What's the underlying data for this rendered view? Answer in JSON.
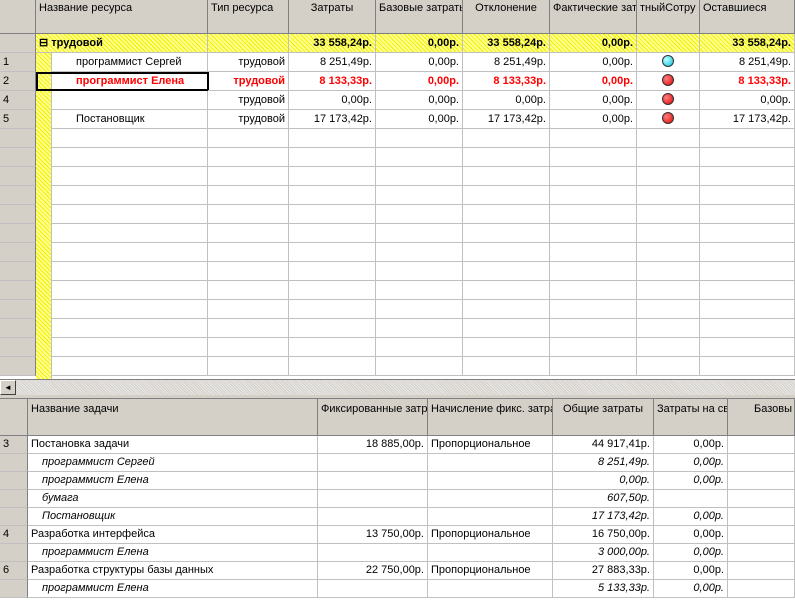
{
  "resource_sheet": {
    "headers": [
      "",
      "Название ресурса",
      "Тип ресурса",
      "Затраты",
      "Базовые затраты",
      "Отклонение",
      "Фактические затраты",
      "тныйСотру",
      "Оставшиеся"
    ],
    "group_row": {
      "name": "трудовой",
      "expand": "⊟",
      "cost": "33 558,24р.",
      "baseline": "0,00р.",
      "variance": "33 558,24р.",
      "actual": "0,00р.",
      "remaining": "33 558,24р."
    },
    "rows": [
      {
        "id": "1",
        "name": "программист Сергей",
        "type": "трудовой",
        "cost": "8 251,49р.",
        "baseline": "0,00р.",
        "variance": "8 251,49р.",
        "actual": "0,00р.",
        "indicator": "cyan",
        "remaining": "8 251,49р.",
        "highlight": false
      },
      {
        "id": "2",
        "name": "программист Елена",
        "type": "трудовой",
        "cost": "8 133,33р.",
        "baseline": "0,00р.",
        "variance": "8 133,33р.",
        "actual": "0,00р.",
        "indicator": "red",
        "remaining": "8 133,33р.",
        "highlight": true
      },
      {
        "id": "4",
        "name": "",
        "type": "трудовой",
        "cost": "0,00р.",
        "baseline": "0,00р.",
        "variance": "0,00р.",
        "actual": "0,00р.",
        "indicator": "red",
        "remaining": "0,00р.",
        "highlight": false
      },
      {
        "id": "5",
        "name": "Постановщик",
        "type": "трудовой",
        "cost": "17 173,42р.",
        "baseline": "0,00р.",
        "variance": "17 173,42р.",
        "actual": "0,00р.",
        "indicator": "red",
        "remaining": "17 173,42р.",
        "highlight": false
      }
    ]
  },
  "scrollbar": {
    "left_arrow": "◄"
  },
  "task_sheet": {
    "headers": [
      "",
      "Название задачи",
      "Фиксированные затраты",
      "Начисление фикс. затрат",
      "Общие затраты",
      "Затраты на сверхурочные",
      "Базовы"
    ],
    "rows": [
      {
        "id": "3",
        "name": "Постановка задачи",
        "fixed": "18 885,00р.",
        "accrual": "Пропорциональное",
        "total": "44 917,41р.",
        "overtime": "0,00р.",
        "sub": false
      },
      {
        "id": "",
        "name": "программист Сергей",
        "fixed": "",
        "accrual": "",
        "total": "8 251,49р.",
        "overtime": "0,00р.",
        "sub": true
      },
      {
        "id": "",
        "name": "программист Елена",
        "fixed": "",
        "accrual": "",
        "total": "0,00р.",
        "overtime": "0,00р.",
        "sub": true
      },
      {
        "id": "",
        "name": "бумага",
        "fixed": "",
        "accrual": "",
        "total": "607,50р.",
        "overtime": "",
        "sub": true
      },
      {
        "id": "",
        "name": "Постановщик",
        "fixed": "",
        "accrual": "",
        "total": "17 173,42р.",
        "overtime": "0,00р.",
        "sub": true
      },
      {
        "id": "4",
        "name": "Разработка интерфейса",
        "fixed": "13 750,00р.",
        "accrual": "Пропорциональное",
        "total": "16 750,00р.",
        "overtime": "0,00р.",
        "sub": false
      },
      {
        "id": "",
        "name": "программист Елена",
        "fixed": "",
        "accrual": "",
        "total": "3 000,00р.",
        "overtime": "0,00р.",
        "sub": true
      },
      {
        "id": "6",
        "name": "Разработка структуры базы данных",
        "fixed": "22 750,00р.",
        "accrual": "Пропорциональное",
        "total": "27 883,33р.",
        "overtime": "0,00р.",
        "sub": false
      },
      {
        "id": "",
        "name": "программист Елена",
        "fixed": "",
        "accrual": "",
        "total": "5 133,33р.",
        "overtime": "0,00р.",
        "sub": true
      }
    ]
  }
}
